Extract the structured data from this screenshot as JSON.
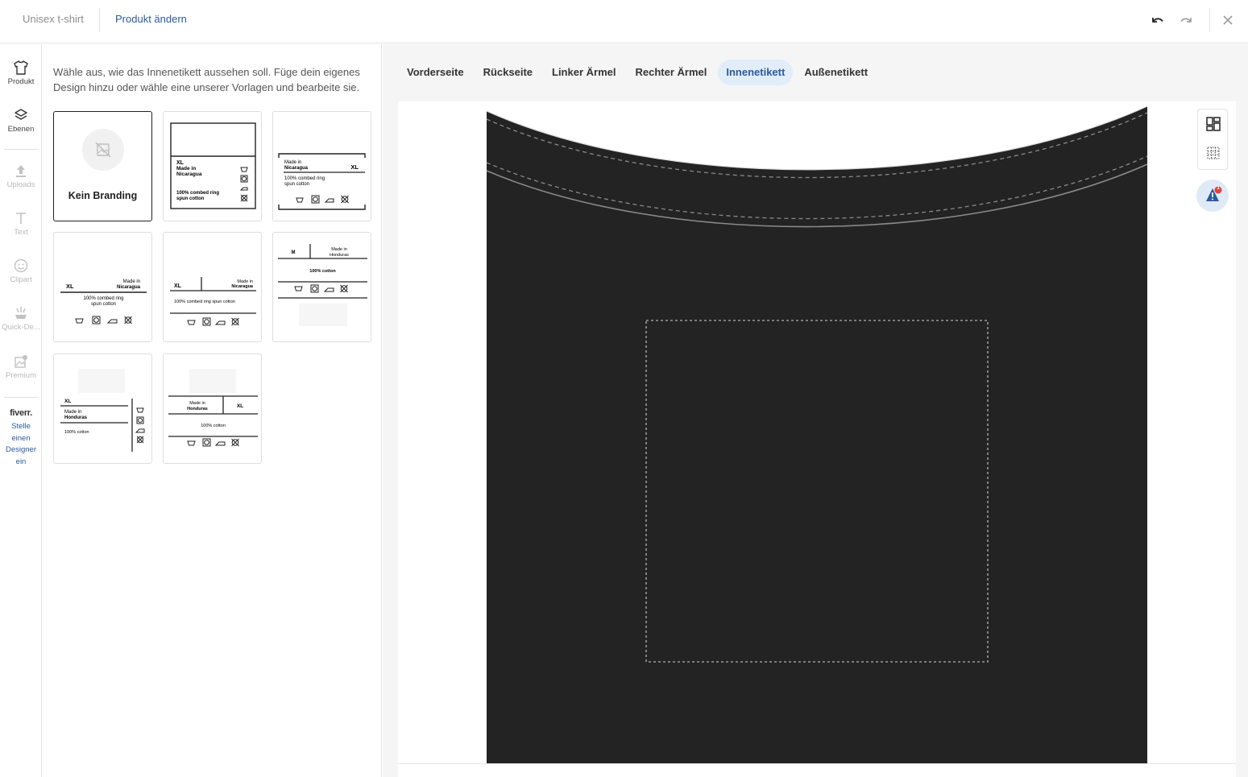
{
  "header": {
    "product_name": "Unisex t-shirt",
    "change_product": "Produkt ändern"
  },
  "sidebar": {
    "items": [
      {
        "label": "Produkt",
        "icon": "tshirt-icon"
      },
      {
        "label": "Ebenen",
        "icon": "layers-icon"
      },
      {
        "label": "Uploads",
        "icon": "upload-icon"
      },
      {
        "label": "Text",
        "icon": "text-icon"
      },
      {
        "label": "Clipart",
        "icon": "smiley-icon"
      },
      {
        "label": "Quick-De...",
        "icon": "quick-design-icon"
      },
      {
        "label": "Premium",
        "icon": "premium-image-icon"
      }
    ],
    "fiverr": {
      "logo": "fiverr.",
      "link_lines": [
        "Stelle",
        "einen",
        "Designer",
        "ein"
      ]
    }
  },
  "panel": {
    "intro": "Wähle aus, wie das Innenetikett aussehen soll. Füge dein eigenes Design hinzu oder wähle eine unserer Vorlagen und bearbeite sie.",
    "no_branding": "Kein Branding",
    "templates": {
      "t1": {
        "size": "XL",
        "made_in": "Made in",
        "country": "Nicaragua",
        "material_1": "100% combed ring",
        "material_2": "spun cotton"
      },
      "t2": {
        "size": "XL",
        "made_in": "Made in",
        "country": "Nicaragua",
        "material_1": "100% combed ring",
        "material_2": "spun cotton"
      },
      "t3": {
        "size": "XL",
        "made_in": "Made in",
        "country": "Nicaragua",
        "material_1": "100% combed ring",
        "material_2": "spun cotton"
      },
      "t4": {
        "size": "XL",
        "made_in": "Made in",
        "country": "Nicaragua",
        "material": "100% combed ring spun cotton"
      },
      "t5": {
        "size": "M",
        "made_in": "Made in",
        "country": "Honduras",
        "material": "100% cotton"
      },
      "t6": {
        "size": "XL",
        "made_in": "Made in",
        "country": "Honduras",
        "material": "100% cotton"
      },
      "t7": {
        "size": "XL",
        "made_in": "Made in",
        "country": "Honduras",
        "material": "100% cotton"
      }
    }
  },
  "tabs": [
    {
      "label": "Vorderseite",
      "active": false
    },
    {
      "label": "Rückseite",
      "active": false
    },
    {
      "label": "Linker Ärmel",
      "active": false
    },
    {
      "label": "Rechter Ärmel",
      "active": false
    },
    {
      "label": "Innenetikett",
      "active": true
    },
    {
      "label": "Außenetikett",
      "active": false
    }
  ],
  "canvas": {
    "garment_color": "#232323",
    "accent_color": "#2a5aa0",
    "alert_count": "1"
  }
}
